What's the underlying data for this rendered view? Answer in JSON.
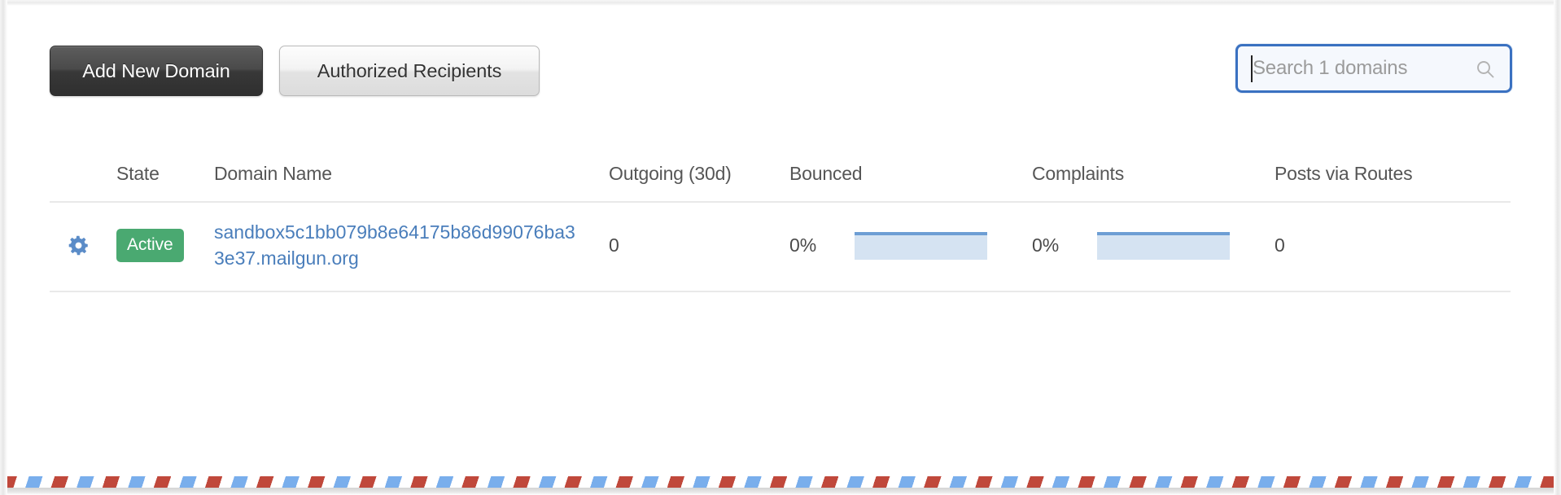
{
  "toolbar": {
    "add_domain_label": "Add New Domain",
    "authorized_recipients_label": "Authorized Recipients"
  },
  "search": {
    "placeholder": "Search 1 domains",
    "value": "",
    "icon": "search-icon",
    "focused": true
  },
  "table": {
    "columns": [
      {
        "key": "gear",
        "label": ""
      },
      {
        "key": "state",
        "label": "State"
      },
      {
        "key": "domain",
        "label": "Domain Name"
      },
      {
        "key": "outgoing",
        "label": "Outgoing (30d)"
      },
      {
        "key": "bounced",
        "label": "Bounced"
      },
      {
        "key": "complaints",
        "label": "Complaints"
      },
      {
        "key": "routes",
        "label": "Posts via Routes"
      }
    ],
    "rows": [
      {
        "gear_icon": "gear-icon",
        "state": "Active",
        "domain": "sandbox5c1bb079b8e64175b86d99076ba33e37.mailgun.org",
        "outgoing": "0",
        "bounced_pct": "0%",
        "complaints_pct": "0%",
        "routes": "0"
      }
    ]
  },
  "colors": {
    "badge_active": "#4aa971",
    "link": "#4a7ebb",
    "search_focus_border": "#3a71c1",
    "sparkline_fill": "#d5e3f2",
    "sparkline_line": "#6d9ed4",
    "stripe_red": "#c0483b",
    "stripe_blue": "#79aeec"
  }
}
